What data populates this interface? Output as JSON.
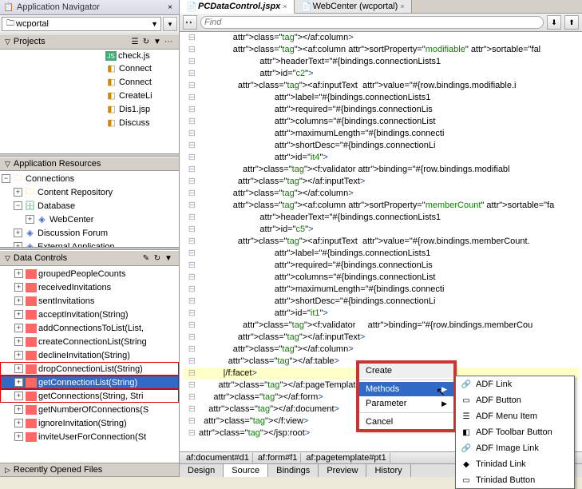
{
  "nav_title": "Application Navigator",
  "search_text": "wcportal",
  "projects_header": "Projects",
  "project_files": [
    {
      "name": "check.js",
      "type": "js"
    },
    {
      "name": "Connect",
      "type": "pkg"
    },
    {
      "name": "Connect",
      "type": "pkg"
    },
    {
      "name": "CreateLi",
      "type": "pkg"
    },
    {
      "name": "Dis1.jsp",
      "type": "pkg"
    },
    {
      "name": "Discuss",
      "type": "pkg"
    }
  ],
  "app_res_header": "Application Resources",
  "connections_root": "Connections",
  "connection_nodes": [
    {
      "name": "Content Repository",
      "expandable": true,
      "depth": 1,
      "icon": "folder"
    },
    {
      "name": "Database",
      "expandable": true,
      "open": true,
      "depth": 1,
      "icon": "db"
    },
    {
      "name": "WebCenter",
      "expandable": true,
      "depth": 2,
      "icon": "blue"
    },
    {
      "name": "Discussion Forum",
      "expandable": true,
      "depth": 1,
      "icon": "blue"
    },
    {
      "name": "External Application",
      "expandable": true,
      "depth": 1,
      "icon": "blue"
    }
  ],
  "data_ctrl_header": "Data Controls",
  "data_controls": [
    {
      "name": "groupedPeopleCounts"
    },
    {
      "name": "receivedInvitations"
    },
    {
      "name": "sentInvitations"
    },
    {
      "name": "acceptInvitation(String)"
    },
    {
      "name": "addConnectionsToList(List,"
    },
    {
      "name": "createConnectionList(String"
    },
    {
      "name": "declineInvitation(String)"
    },
    {
      "name": "dropConnectionList(String)",
      "red": true
    },
    {
      "name": "getConnectionList(String)",
      "sel": true,
      "red": true
    },
    {
      "name": "getConnections(String, Stri",
      "red": true
    },
    {
      "name": "getNumberOfConnections(S"
    },
    {
      "name": "ignoreInvitation(String)"
    },
    {
      "name": "inviteUserForConnection(St"
    }
  ],
  "recent_header": "Recently Opened Files",
  "tabs": [
    {
      "label": "PCDataControl.jspx",
      "active": true
    },
    {
      "label": "WebCenter (wcportal)",
      "active": false
    }
  ],
  "find_placeholder": "Find",
  "code_lines": [
    {
      "text": "</af:column>",
      "pad": 14
    },
    {
      "text": "<af:column sortProperty=\"modifiable\" sortable=\"fal",
      "pad": 14
    },
    {
      "text": "           headerText=\"#{bindings.connectionLists1",
      "pad": 14
    },
    {
      "text": "           id=\"c2\">",
      "pad": 14
    },
    {
      "text": "  <af:inputText  value=\"#{row.bindings.modifiable.i",
      "pad": 14
    },
    {
      "text": "                 label=\"#{bindings.connectionLists1",
      "pad": 14
    },
    {
      "text": "                 required=\"#{bindings.connectionLis",
      "pad": 14
    },
    {
      "text": "                 columns=\"#{bindings.connectionList",
      "pad": 14
    },
    {
      "text": "                 maximumLength=\"#{bindings.connecti",
      "pad": 14
    },
    {
      "text": "                 shortDesc=\"#{bindings.connectionLi",
      "pad": 14
    },
    {
      "text": "                 id=\"it4\">",
      "pad": 14
    },
    {
      "text": "    <f:validator binding=\"#{row.bindings.modifiabl",
      "pad": 14
    },
    {
      "text": "  </af:inputText>",
      "pad": 14
    },
    {
      "text": "</af:column>",
      "pad": 14
    },
    {
      "text": "<af:column sortProperty=\"memberCount\" sortable=\"fa",
      "pad": 14
    },
    {
      "text": "           headerText=\"#{bindings.connectionLists1",
      "pad": 14
    },
    {
      "text": "           id=\"c5\">",
      "pad": 14
    },
    {
      "text": "  <af:inputText  value=\"#{row.bindings.memberCount.",
      "pad": 14
    },
    {
      "text": "                 label=\"#{bindings.connectionLists1",
      "pad": 14
    },
    {
      "text": "                 required=\"#{bindings.connectionLis",
      "pad": 14
    },
    {
      "text": "                 columns=\"#{bindings.connectionList",
      "pad": 14
    },
    {
      "text": "                 maximumLength=\"#{bindings.connecti",
      "pad": 14
    },
    {
      "text": "                 shortDesc=\"#{bindings.connectionLi",
      "pad": 14
    },
    {
      "text": "                 id=\"it1\">",
      "pad": 14
    },
    {
      "text": "    <f:validator     binding=\"#{row.bindings.memberCou",
      "pad": 14
    },
    {
      "text": "  </af:inputText>",
      "pad": 14
    },
    {
      "text": "</af:column>",
      "pad": 14
    },
    {
      "text": "</af:table>",
      "pad": 12
    },
    {
      "text": "|/f:facet>",
      "pad": 10,
      "hl": true
    },
    {
      "text": "</af:pageTemplate>",
      "pad": 8
    },
    {
      "text": "</af:form>",
      "pad": 6
    },
    {
      "text": "</af:document>",
      "pad": 4
    },
    {
      "text": "</f:view>",
      "pad": 2
    },
    {
      "text": "</jsp:root>",
      "pad": 0
    }
  ],
  "path_segments": [
    "af:document#d1",
    "af:form#f1",
    "af:pagetemplate#pt1"
  ],
  "bottom_tabs": [
    "Design",
    "Source",
    "Bindings",
    "Preview",
    "History"
  ],
  "active_btab": "Source",
  "ctx": {
    "title": "Create",
    "items": [
      {
        "label": "Methods",
        "sel": true,
        "sub": true
      },
      {
        "label": "Parameter",
        "sub": true
      }
    ],
    "cancel": "Cancel"
  },
  "submenu": [
    {
      "label": "ADF Link",
      "icon": "🔗"
    },
    {
      "label": "ADF Button",
      "icon": "▭"
    },
    {
      "label": "ADF Menu Item",
      "icon": "☰"
    },
    {
      "label": "ADF Toolbar Button",
      "icon": "◧"
    },
    {
      "label": "ADF Image Link",
      "icon": "🔗"
    },
    {
      "label": "Trinidad Link",
      "icon": "◆"
    },
    {
      "label": "Trinidad Button",
      "icon": "▭"
    }
  ]
}
